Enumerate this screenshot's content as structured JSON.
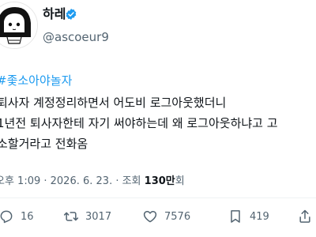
{
  "tweet": {
    "display_name": "하레",
    "handle": "@ascoeur9",
    "hashtag": "#좇소아야놀자",
    "body_lines": [
      "퇴사자 계정정리하면서 어도비 로그아웃했더니",
      "1년전 퇴사자한테 자기 써야하는데 왜 로그아웃하냐고 고",
      "소할거라고 전화옴"
    ],
    "timestamp": "오후 1:09 · 2026. 6. 23. · 조회 ",
    "views_count": "130만",
    "views_suffix": "회"
  },
  "actions": {
    "replies": "16",
    "retweets": "3017",
    "likes": "7576",
    "bookmarks": "419"
  },
  "icons": {
    "verified": "verified-badge-icon",
    "reply": "reply-icon",
    "retweet": "retweet-icon",
    "like": "heart-icon",
    "bookmark": "bookmark-icon",
    "share": "share-icon"
  },
  "colors": {
    "accent": "#1d9bf0",
    "text": "#0f1419",
    "secondary": "#536471"
  }
}
